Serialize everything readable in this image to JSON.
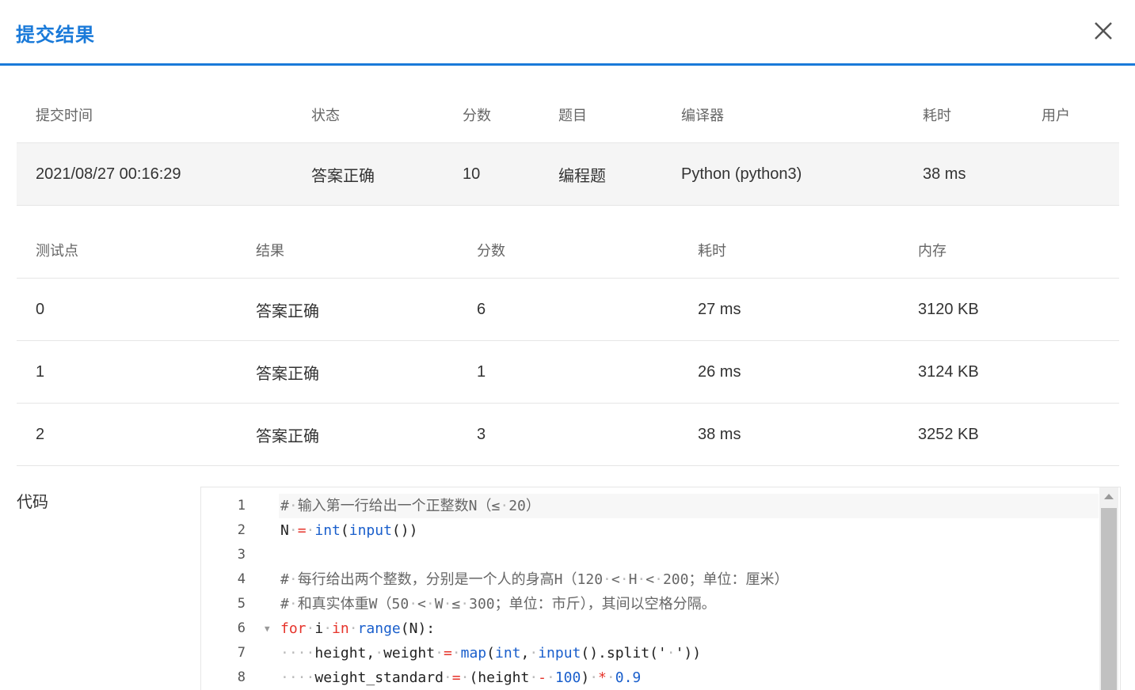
{
  "dialog": {
    "title": "提交结果"
  },
  "submission": {
    "headers": [
      "提交时间",
      "状态",
      "分数",
      "题目",
      "编译器",
      "耗时",
      "用户"
    ],
    "row": [
      "2021/08/27 00:16:29",
      "答案正确",
      "10",
      "编程题",
      "Python (python3)",
      "38 ms",
      ""
    ]
  },
  "cases": {
    "headers": [
      "测试点",
      "结果",
      "分数",
      "耗时",
      "内存"
    ],
    "rows": [
      [
        "0",
        "答案正确",
        "6",
        "27 ms",
        "3120 KB"
      ],
      [
        "1",
        "答案正确",
        "1",
        "26 ms",
        "3124 KB"
      ],
      [
        "2",
        "答案正确",
        "3",
        "38 ms",
        "3252 KB"
      ]
    ]
  },
  "code": {
    "label": "代码",
    "line_numbers": [
      "1",
      "2",
      "3",
      "4",
      "5",
      "6",
      "7",
      "8"
    ],
    "colors": {
      "keyword": "#e6332a",
      "builtin": "#1a5fcc",
      "accent": "#1a7ad9"
    }
  },
  "icons": {
    "close": "close-icon",
    "fold": "fold-arrow-icon",
    "scroll": "scroll-up-icon"
  }
}
